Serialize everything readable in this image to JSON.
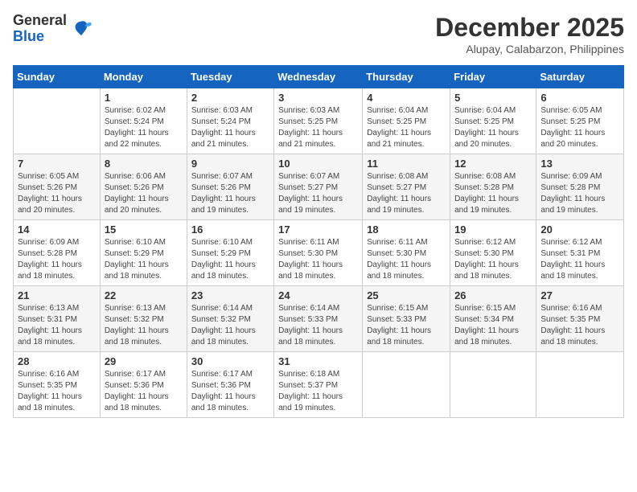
{
  "header": {
    "logo": {
      "general": "General",
      "blue": "Blue"
    },
    "title": "December 2025",
    "location": "Alupay, Calabarzon, Philippines"
  },
  "weekdays": [
    "Sunday",
    "Monday",
    "Tuesday",
    "Wednesday",
    "Thursday",
    "Friday",
    "Saturday"
  ],
  "weeks": [
    [
      {
        "day": "",
        "sunrise": "",
        "sunset": "",
        "daylight": ""
      },
      {
        "day": "1",
        "sunrise": "6:02 AM",
        "sunset": "5:24 PM",
        "daylight": "11 hours and 22 minutes."
      },
      {
        "day": "2",
        "sunrise": "6:03 AM",
        "sunset": "5:24 PM",
        "daylight": "11 hours and 21 minutes."
      },
      {
        "day": "3",
        "sunrise": "6:03 AM",
        "sunset": "5:25 PM",
        "daylight": "11 hours and 21 minutes."
      },
      {
        "day": "4",
        "sunrise": "6:04 AM",
        "sunset": "5:25 PM",
        "daylight": "11 hours and 21 minutes."
      },
      {
        "day": "5",
        "sunrise": "6:04 AM",
        "sunset": "5:25 PM",
        "daylight": "11 hours and 20 minutes."
      },
      {
        "day": "6",
        "sunrise": "6:05 AM",
        "sunset": "5:25 PM",
        "daylight": "11 hours and 20 minutes."
      }
    ],
    [
      {
        "day": "7",
        "sunrise": "6:05 AM",
        "sunset": "5:26 PM",
        "daylight": "11 hours and 20 minutes."
      },
      {
        "day": "8",
        "sunrise": "6:06 AM",
        "sunset": "5:26 PM",
        "daylight": "11 hours and 20 minutes."
      },
      {
        "day": "9",
        "sunrise": "6:07 AM",
        "sunset": "5:26 PM",
        "daylight": "11 hours and 19 minutes."
      },
      {
        "day": "10",
        "sunrise": "6:07 AM",
        "sunset": "5:27 PM",
        "daylight": "11 hours and 19 minutes."
      },
      {
        "day": "11",
        "sunrise": "6:08 AM",
        "sunset": "5:27 PM",
        "daylight": "11 hours and 19 minutes."
      },
      {
        "day": "12",
        "sunrise": "6:08 AM",
        "sunset": "5:28 PM",
        "daylight": "11 hours and 19 minutes."
      },
      {
        "day": "13",
        "sunrise": "6:09 AM",
        "sunset": "5:28 PM",
        "daylight": "11 hours and 19 minutes."
      }
    ],
    [
      {
        "day": "14",
        "sunrise": "6:09 AM",
        "sunset": "5:28 PM",
        "daylight": "11 hours and 18 minutes."
      },
      {
        "day": "15",
        "sunrise": "6:10 AM",
        "sunset": "5:29 PM",
        "daylight": "11 hours and 18 minutes."
      },
      {
        "day": "16",
        "sunrise": "6:10 AM",
        "sunset": "5:29 PM",
        "daylight": "11 hours and 18 minutes."
      },
      {
        "day": "17",
        "sunrise": "6:11 AM",
        "sunset": "5:30 PM",
        "daylight": "11 hours and 18 minutes."
      },
      {
        "day": "18",
        "sunrise": "6:11 AM",
        "sunset": "5:30 PM",
        "daylight": "11 hours and 18 minutes."
      },
      {
        "day": "19",
        "sunrise": "6:12 AM",
        "sunset": "5:30 PM",
        "daylight": "11 hours and 18 minutes."
      },
      {
        "day": "20",
        "sunrise": "6:12 AM",
        "sunset": "5:31 PM",
        "daylight": "11 hours and 18 minutes."
      }
    ],
    [
      {
        "day": "21",
        "sunrise": "6:13 AM",
        "sunset": "5:31 PM",
        "daylight": "11 hours and 18 minutes."
      },
      {
        "day": "22",
        "sunrise": "6:13 AM",
        "sunset": "5:32 PM",
        "daylight": "11 hours and 18 minutes."
      },
      {
        "day": "23",
        "sunrise": "6:14 AM",
        "sunset": "5:32 PM",
        "daylight": "11 hours and 18 minutes."
      },
      {
        "day": "24",
        "sunrise": "6:14 AM",
        "sunset": "5:33 PM",
        "daylight": "11 hours and 18 minutes."
      },
      {
        "day": "25",
        "sunrise": "6:15 AM",
        "sunset": "5:33 PM",
        "daylight": "11 hours and 18 minutes."
      },
      {
        "day": "26",
        "sunrise": "6:15 AM",
        "sunset": "5:34 PM",
        "daylight": "11 hours and 18 minutes."
      },
      {
        "day": "27",
        "sunrise": "6:16 AM",
        "sunset": "5:35 PM",
        "daylight": "11 hours and 18 minutes."
      }
    ],
    [
      {
        "day": "28",
        "sunrise": "6:16 AM",
        "sunset": "5:35 PM",
        "daylight": "11 hours and 18 minutes."
      },
      {
        "day": "29",
        "sunrise": "6:17 AM",
        "sunset": "5:36 PM",
        "daylight": "11 hours and 18 minutes."
      },
      {
        "day": "30",
        "sunrise": "6:17 AM",
        "sunset": "5:36 PM",
        "daylight": "11 hours and 18 minutes."
      },
      {
        "day": "31",
        "sunrise": "6:18 AM",
        "sunset": "5:37 PM",
        "daylight": "11 hours and 19 minutes."
      },
      {
        "day": "",
        "sunrise": "",
        "sunset": "",
        "daylight": ""
      },
      {
        "day": "",
        "sunrise": "",
        "sunset": "",
        "daylight": ""
      },
      {
        "day": "",
        "sunrise": "",
        "sunset": "",
        "daylight": ""
      }
    ]
  ],
  "labels": {
    "sunrise_prefix": "Sunrise: ",
    "sunset_prefix": "Sunset: ",
    "daylight_prefix": "Daylight: "
  }
}
